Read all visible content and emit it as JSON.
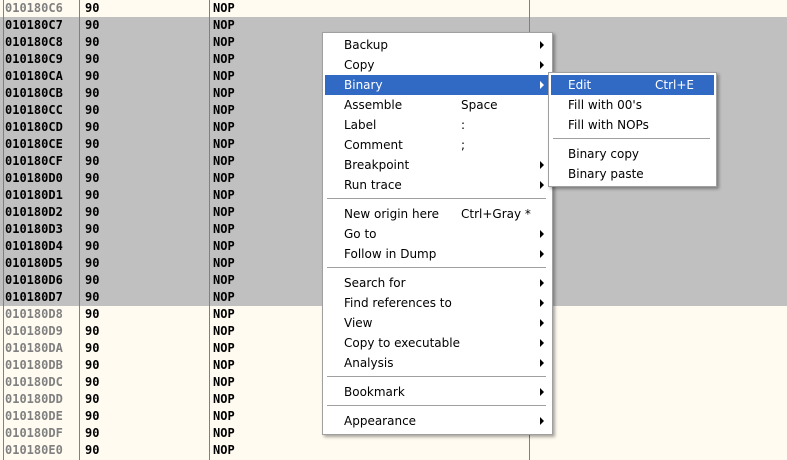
{
  "disasm": {
    "rows": [
      {
        "addr": "010180C6",
        "hex": "90",
        "op": "NOP",
        "sel": false
      },
      {
        "addr": "010180C7",
        "hex": "90",
        "op": "NOP",
        "sel": true
      },
      {
        "addr": "010180C8",
        "hex": "90",
        "op": "NOP",
        "sel": true
      },
      {
        "addr": "010180C9",
        "hex": "90",
        "op": "NOP",
        "sel": true
      },
      {
        "addr": "010180CA",
        "hex": "90",
        "op": "NOP",
        "sel": true
      },
      {
        "addr": "010180CB",
        "hex": "90",
        "op": "NOP",
        "sel": true
      },
      {
        "addr": "010180CC",
        "hex": "90",
        "op": "NOP",
        "sel": true
      },
      {
        "addr": "010180CD",
        "hex": "90",
        "op": "NOP",
        "sel": true
      },
      {
        "addr": "010180CE",
        "hex": "90",
        "op": "NOP",
        "sel": true
      },
      {
        "addr": "010180CF",
        "hex": "90",
        "op": "NOP",
        "sel": true
      },
      {
        "addr": "010180D0",
        "hex": "90",
        "op": "NOP",
        "sel": true
      },
      {
        "addr": "010180D1",
        "hex": "90",
        "op": "NOP",
        "sel": true
      },
      {
        "addr": "010180D2",
        "hex": "90",
        "op": "NOP",
        "sel": true
      },
      {
        "addr": "010180D3",
        "hex": "90",
        "op": "NOP",
        "sel": true
      },
      {
        "addr": "010180D4",
        "hex": "90",
        "op": "NOP",
        "sel": true
      },
      {
        "addr": "010180D5",
        "hex": "90",
        "op": "NOP",
        "sel": true
      },
      {
        "addr": "010180D6",
        "hex": "90",
        "op": "NOP",
        "sel": true
      },
      {
        "addr": "010180D7",
        "hex": "90",
        "op": "NOP",
        "sel": true
      },
      {
        "addr": "010180D8",
        "hex": "90",
        "op": "NOP",
        "sel": false
      },
      {
        "addr": "010180D9",
        "hex": "90",
        "op": "NOP",
        "sel": false
      },
      {
        "addr": "010180DA",
        "hex": "90",
        "op": "NOP",
        "sel": false
      },
      {
        "addr": "010180DB",
        "hex": "90",
        "op": "NOP",
        "sel": false
      },
      {
        "addr": "010180DC",
        "hex": "90",
        "op": "NOP",
        "sel": false
      },
      {
        "addr": "010180DD",
        "hex": "90",
        "op": "NOP",
        "sel": false
      },
      {
        "addr": "010180DE",
        "hex": "90",
        "op": "NOP",
        "sel": false
      },
      {
        "addr": "010180DF",
        "hex": "90",
        "op": "NOP",
        "sel": false
      },
      {
        "addr": "010180E0",
        "hex": "90",
        "op": "NOP",
        "sel": false
      }
    ]
  },
  "context_menu": {
    "items": [
      {
        "label": "Backup",
        "shortcut": "",
        "submenu": true
      },
      {
        "label": "Copy",
        "shortcut": "",
        "submenu": true
      },
      {
        "label": "Binary",
        "shortcut": "",
        "submenu": true,
        "highlighted": true
      },
      {
        "label": "Assemble",
        "shortcut": "Space",
        "submenu": false
      },
      {
        "label": "Label",
        "shortcut": ":",
        "submenu": false
      },
      {
        "label": "Comment",
        "shortcut": ";",
        "submenu": false
      },
      {
        "label": "Breakpoint",
        "shortcut": "",
        "submenu": true
      },
      {
        "label": "Run trace",
        "shortcut": "",
        "submenu": true
      },
      {
        "separator": true
      },
      {
        "label": "New origin here",
        "shortcut": "Ctrl+Gray *",
        "submenu": false
      },
      {
        "label": "Go to",
        "shortcut": "",
        "submenu": true
      },
      {
        "label": "Follow in Dump",
        "shortcut": "",
        "submenu": true
      },
      {
        "separator": true
      },
      {
        "label": "Search for",
        "shortcut": "",
        "submenu": true
      },
      {
        "label": "Find references to",
        "shortcut": "",
        "submenu": true
      },
      {
        "label": "View",
        "shortcut": "",
        "submenu": true
      },
      {
        "label": "Copy to executable",
        "shortcut": "",
        "submenu": true
      },
      {
        "label": "Analysis",
        "shortcut": "",
        "submenu": true
      },
      {
        "separator": true
      },
      {
        "label": "Bookmark",
        "shortcut": "",
        "submenu": true
      },
      {
        "separator": true
      },
      {
        "label": "Appearance",
        "shortcut": "",
        "submenu": true
      }
    ]
  },
  "binary_submenu": {
    "items": [
      {
        "label": "Edit",
        "shortcut": "Ctrl+E",
        "highlighted": true
      },
      {
        "label": "Fill with 00's",
        "shortcut": ""
      },
      {
        "label": "Fill with NOPs",
        "shortcut": ""
      },
      {
        "separator": true
      },
      {
        "label": "Binary copy",
        "shortcut": ""
      },
      {
        "label": "Binary paste",
        "shortcut": ""
      }
    ]
  },
  "colors": {
    "background": "#fffbf0",
    "selection": "#c0c0c0",
    "menu_highlight": "#316ac5"
  }
}
